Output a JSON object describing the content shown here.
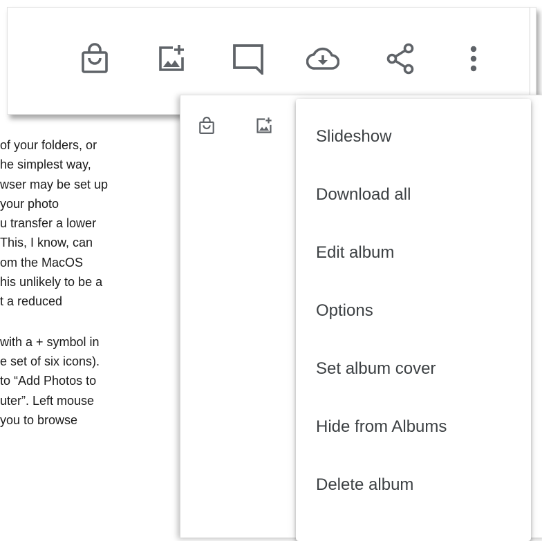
{
  "document": {
    "lines": [
      "of your folders, or",
      "he simplest way,",
      "wser may be set up",
      " your photo",
      "u transfer a lower",
      "This, I know, can",
      "om the MacOS",
      "his unlikely to be a",
      "t a reduced",
      "",
      " with a + symbol in",
      "e set of six icons).",
      "to “Add Photos to",
      "uter”. Left mouse",
      "you to browse"
    ]
  },
  "toolbar": {
    "icons": [
      "shopping-bag-icon",
      "add-photo-icon",
      "comment-icon",
      "cloud-download-icon",
      "share-icon",
      "more-vert-icon"
    ],
    "accent": "#5f6368"
  },
  "menu": {
    "items": [
      "Slideshow",
      "Download all",
      "Edit album",
      "Options",
      "Set album cover",
      "Hide from Albums",
      "Delete album"
    ]
  }
}
